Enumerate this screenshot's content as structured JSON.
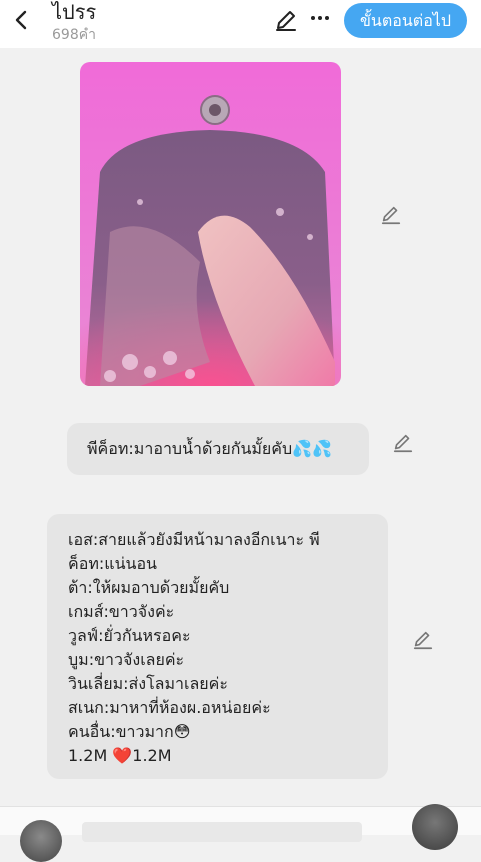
{
  "header": {
    "title": "ไปรร",
    "subtitle": "698คำ",
    "next_label": "ขั้นตอนต่อไป"
  },
  "icons": {
    "back": "chevron-left-icon",
    "edit": "pencil-icon",
    "more": "more-dots-icon"
  },
  "messages": {
    "bubble1": "พีค็อท:มาอาบน้ำด้วยกันมั้ยคับ💦💦",
    "bubble2_lines": [
      "เอส:สายแล้วยังมีหน้ามาลงอีกเนาะ พี",
      "ค็อท:แน่นอน",
      "ต้า:ให้ผมอาบด้วยมั้ยคับ",
      "เกมส์:ขาวจังค่ะ",
      "วูลฟ์:ยั่วกันหรอคะ",
      "บูม:ขาวจังเลยค่ะ",
      "วินเลี่ยม:ส่งโลมาเลยค่ะ",
      "สเนก:มาหาที่ห้องผ.อหน่อยค่ะ",
      "คนอื่น:ขาวมาก😳",
      "1.2M ❤️1.2M"
    ]
  },
  "colors": {
    "accent": "#45a7f2",
    "bubble": "#e5e5e5",
    "background": "#f1f1f1"
  }
}
